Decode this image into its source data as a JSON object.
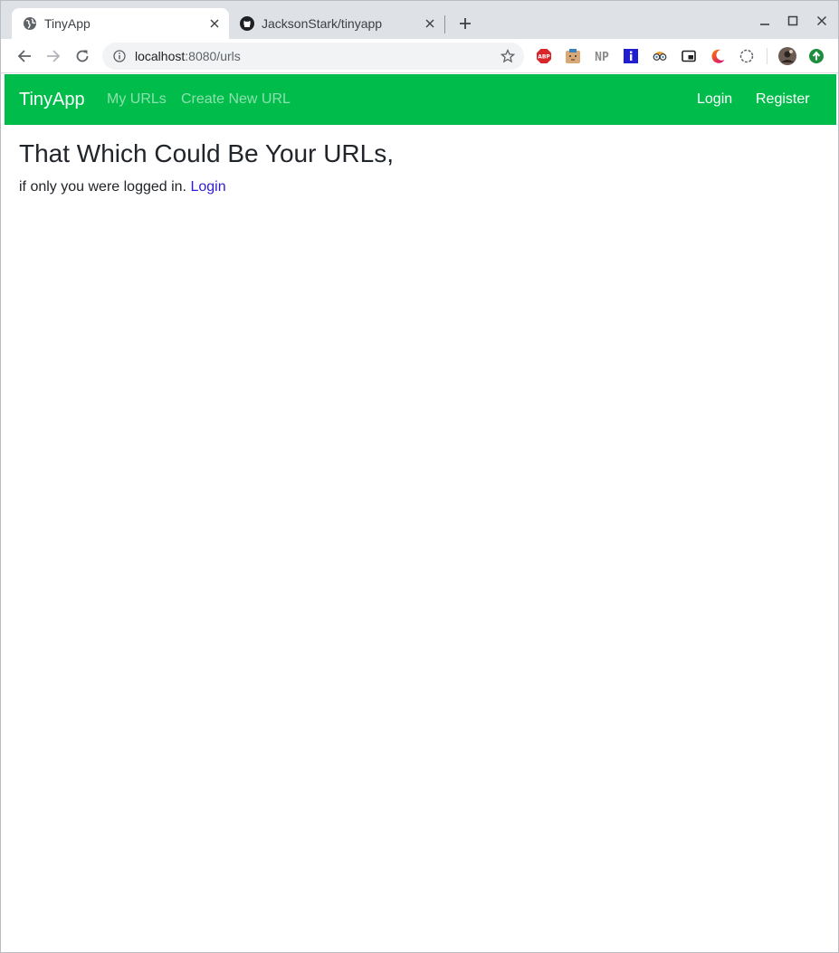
{
  "browser": {
    "tabs": [
      {
        "title": "TinyApp",
        "icon": "globe-icon",
        "active": true
      },
      {
        "title": "JacksonStark/tinyapp",
        "icon": "github-icon",
        "active": false
      }
    ],
    "address": {
      "host": "localhost",
      "path": ":8080/urls"
    },
    "extensions": [
      "abp-icon",
      "cookie-icon",
      "np-icon",
      "info-icon",
      "glasses-icon",
      "pip-icon",
      "moon-icon",
      "sync-icon",
      "profile-avatar",
      "update-icon"
    ],
    "extension_labels": {
      "abp": "ABP",
      "np": "NP"
    }
  },
  "navbar": {
    "brand": "TinyApp",
    "links": [
      "My URLs",
      "Create New URL"
    ],
    "right_links": [
      "Login",
      "Register"
    ],
    "color": "#00bc4a"
  },
  "main": {
    "heading": "That Which Could Be Your URLs,",
    "subtext": "if only you were logged in.",
    "login_link": "Login",
    "link_color": "#2f1bd6"
  }
}
